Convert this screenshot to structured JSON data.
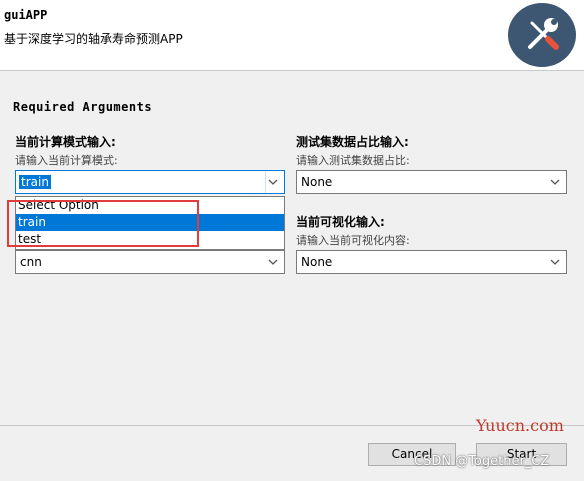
{
  "header": {
    "title": "guiAPP",
    "subtitle": "基于深度学习的轴承寿命预测APP",
    "logo_icon": "tools-icon"
  },
  "section": {
    "title": "Required Arguments"
  },
  "fields": {
    "mode": {
      "label": "当前计算模式输入:",
      "hint": "请输入当前计算模式:",
      "value": "train"
    },
    "ratio": {
      "label": "测试集数据占比输入:",
      "hint": "请输入测试集数据占比:",
      "value": "None"
    },
    "model": {
      "value": "cnn"
    },
    "visual": {
      "label": "当前可视化输入:",
      "hint": "请输入当前可视化内容:",
      "value": "None"
    }
  },
  "dropdown": {
    "options": [
      "Select Option",
      "train",
      "test"
    ],
    "selected": "train"
  },
  "buttons": {
    "cancel": "Cancel",
    "start": "Start"
  },
  "watermark": {
    "site": "Yuucn.com",
    "credit": "CSDN @Together_CZ"
  },
  "colors": {
    "accent": "#0078d7",
    "highlight": "#e03c3c",
    "logo_bg": "#3d5773"
  }
}
